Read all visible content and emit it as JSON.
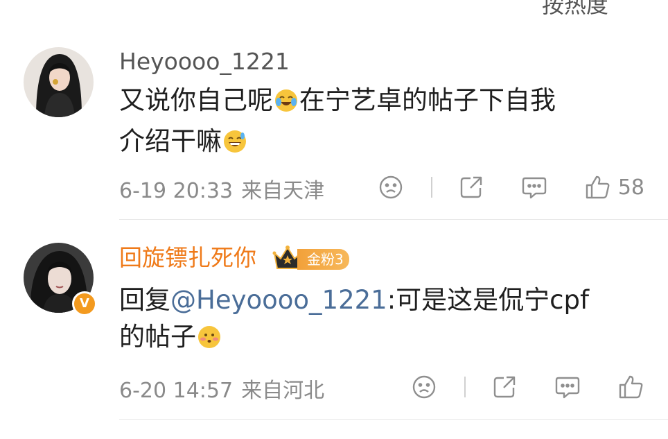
{
  "top_partial_text": "按热度",
  "comments": [
    {
      "username": "Heyoooo_1221",
      "text_line1_a": "又说你自己呢",
      "text_line1_emoji": "cry-laugh-emoji",
      "text_line1_b": "在宁艺卓的帖子下自我",
      "text_line2_a": "介绍干嘛",
      "text_line2_emoji": "grin-sweat-emoji",
      "date": "6-19 20:33",
      "location": "来自天津",
      "like_count": "58"
    },
    {
      "username": "回旋镖扎死你",
      "fan_badge": "金粉3",
      "reply_prefix": "回复",
      "mention": "@Heyoooo_1221",
      "text_line1_b": ":可是这是侃宁cpf",
      "text_line2_a": "的帖子",
      "text_line2_emoji": "blush-emoji",
      "date": "6-20 14:57",
      "location": "来自河北",
      "like_count": ""
    }
  ],
  "colors": {
    "username_plain": "#555555",
    "username_vip": "#ef7a19",
    "mention": "#4a6d98",
    "meta": "#8a8a8a"
  }
}
